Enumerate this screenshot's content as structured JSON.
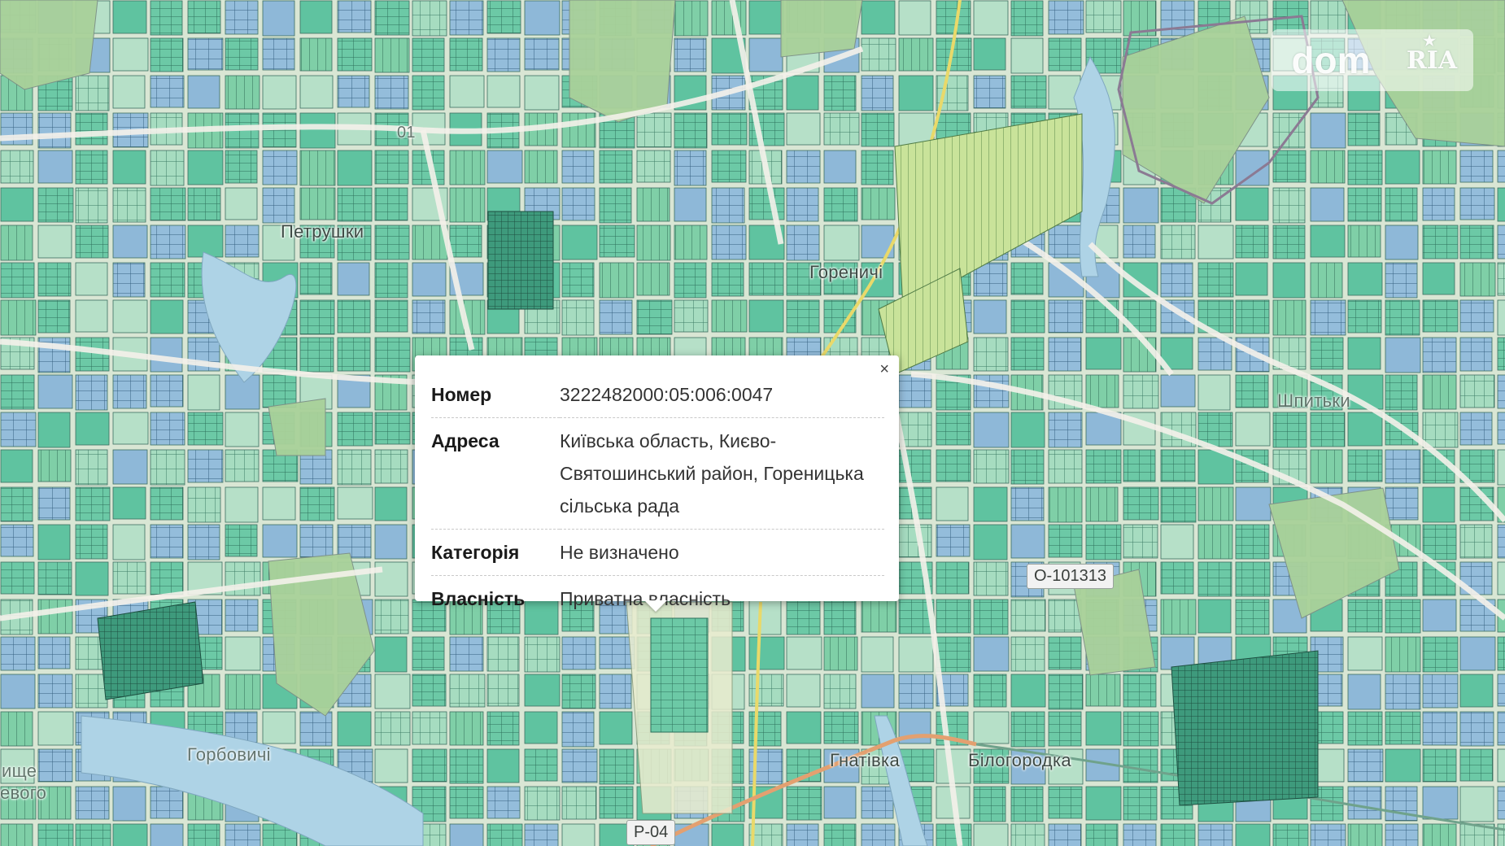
{
  "map": {
    "place_labels": [
      {
        "text": "Петрушки",
        "id": "petrushky"
      },
      {
        "text": "Гореничі",
        "id": "horenychi"
      },
      {
        "text": "Шпитьки",
        "id": "shpytky"
      },
      {
        "text": "Гнатівка",
        "id": "hnativka"
      },
      {
        "text": "Білогородка",
        "id": "bilohorodka"
      },
      {
        "text": "Горбовичі",
        "id": "horbovychi"
      },
      {
        "text": "ище",
        "id": "ishche"
      },
      {
        "text": "евого",
        "id": "evoho"
      }
    ],
    "road_shields": [
      {
        "text": "О-101313",
        "id": "o-101313"
      },
      {
        "text": "Р-04",
        "id": "r-04"
      },
      {
        "text": "01",
        "id": "road-01"
      }
    ],
    "colors": {
      "parcel_green": "#5fc3a0",
      "parcel_blue": "#8eb8d8",
      "parcel_light": "#b6e0c8",
      "forest": "#a9d19a",
      "water": "#aed3e6",
      "road": "#f4f1ea",
      "yellow_road": "#e9d96a",
      "orange_road": "#e3a070"
    }
  },
  "logo": {
    "dom": "dom",
    "ria": "RIA"
  },
  "popup": {
    "close_label": "×",
    "rows": [
      {
        "key": "Номер",
        "value": "3222482000:05:006:0047"
      },
      {
        "key": "Адреса",
        "value": "Київська область, Києво-Святошинський район, Гореницька сільська рада"
      },
      {
        "key": "Категорія",
        "value": "Не визначено"
      },
      {
        "key": "Власність",
        "value": "Приватна власність"
      }
    ]
  }
}
